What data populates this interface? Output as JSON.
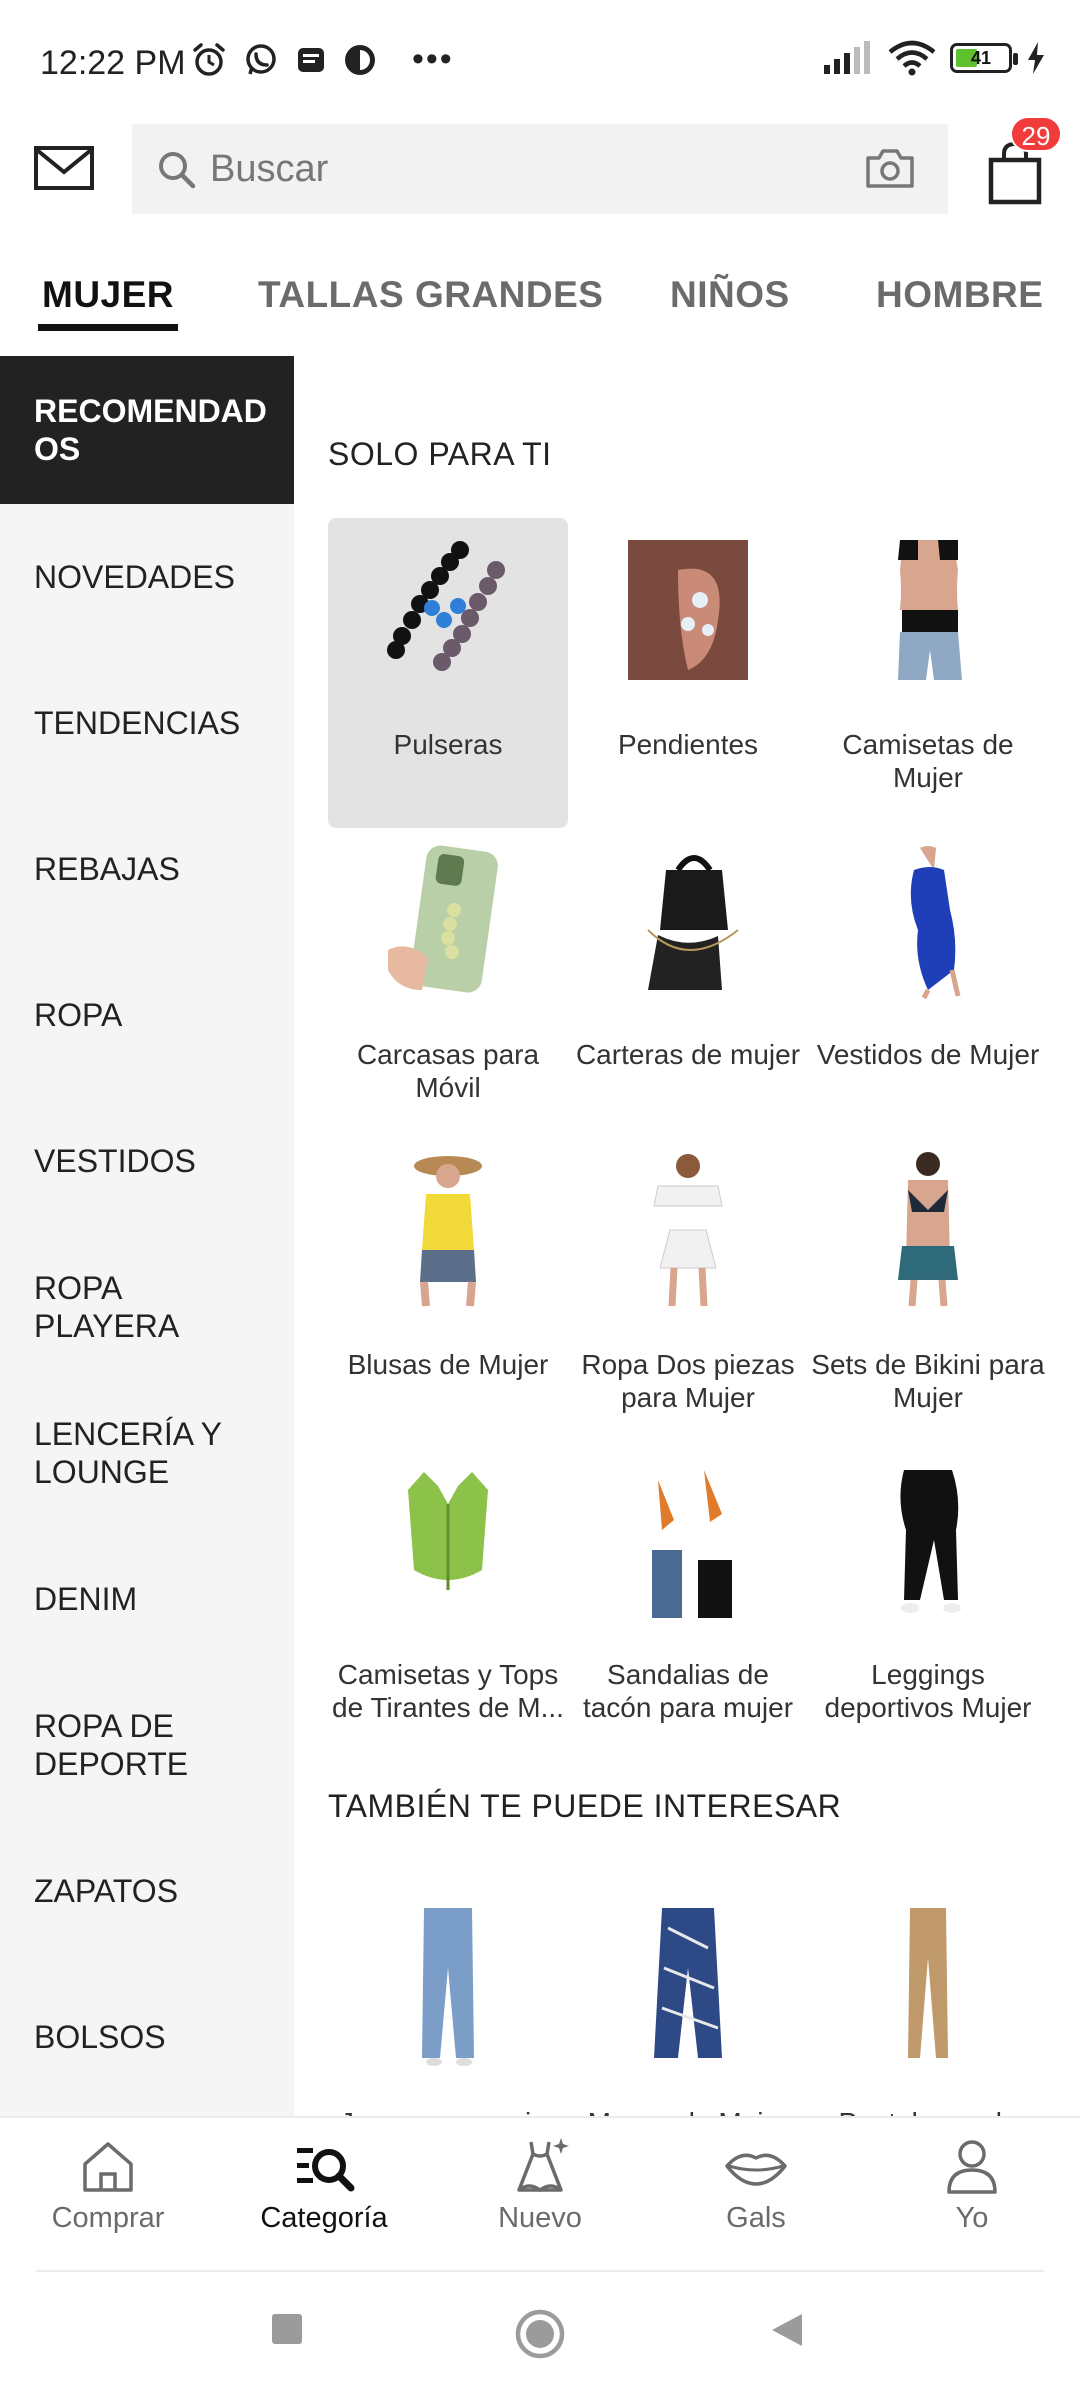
{
  "status_bar": {
    "time": "12:22 PM",
    "battery": "41",
    "battery_level": 0.41
  },
  "header": {
    "search_placeholder": "Buscar",
    "cart_count": "29"
  },
  "tabs": [
    {
      "label": "MUJER",
      "active": true
    },
    {
      "label": "TALLAS GRANDES",
      "active": false
    },
    {
      "label": "NIÑOS",
      "active": false
    },
    {
      "label": "HOMBRE",
      "active": false
    }
  ],
  "sidebar": {
    "items": [
      {
        "label": "RECOMENDADOS",
        "active": true
      },
      {
        "label": "NOVEDADES"
      },
      {
        "label": "TENDENCIAS"
      },
      {
        "label": "REBAJAS"
      },
      {
        "label": "ROPA"
      },
      {
        "label": "VESTIDOS"
      },
      {
        "label": "ROPA PLAYERA"
      },
      {
        "label": "LENCERÍA Y LOUNGE"
      },
      {
        "label": "DENIM"
      },
      {
        "label": "ROPA DE DEPORTE"
      },
      {
        "label": "ZAPATOS"
      },
      {
        "label": "BOLSOS"
      }
    ]
  },
  "sections": {
    "for_you_title": "SOLO PARA TI",
    "for_you": [
      {
        "label": "Pulseras",
        "icon": "bracelets-thumbnail"
      },
      {
        "label": "Pendientes",
        "icon": "earrings-thumbnail"
      },
      {
        "label": "Camisetas de Mujer",
        "icon": "tshirts-thumbnail"
      },
      {
        "label": "Carcasas para Móvil",
        "icon": "phone-case-thumbnail"
      },
      {
        "label": "Carteras de mujer",
        "icon": "handbag-thumbnail"
      },
      {
        "label": "Vestidos de Mujer",
        "icon": "dress-thumbnail"
      },
      {
        "label": "Blusas de Mujer",
        "icon": "blouse-thumbnail"
      },
      {
        "label": "Ropa Dos piezas para Mujer",
        "icon": "two-piece-thumbnail"
      },
      {
        "label": "Sets de Bikini para Mujer",
        "icon": "bikini-thumbnail"
      },
      {
        "label": "Camisetas y Tops de Tirantes de M...",
        "icon": "tank-top-thumbnail"
      },
      {
        "label": "Sandalias de tacón para mujer",
        "icon": "sandals-thumbnail"
      },
      {
        "label": "Leggings deportivos Mujer",
        "icon": "leggings-thumbnail"
      }
    ],
    "also_title": "TAMBIÉN TE PUEDE INTERESAR",
    "also": [
      {
        "label": "Jeans para mujer",
        "icon": "jeans-thumbnail"
      },
      {
        "label": "Monos de Mujer",
        "icon": "jumpsuit-thumbnail"
      },
      {
        "label": "Pantalones de Mujer",
        "icon": "pants-thumbnail"
      }
    ]
  },
  "bottom_nav": [
    {
      "label": "Comprar",
      "icon": "home-icon"
    },
    {
      "label": "Categoría",
      "icon": "category-search-icon",
      "active": true
    },
    {
      "label": "Nuevo",
      "icon": "new-dress-icon"
    },
    {
      "label": "Gals",
      "icon": "lips-icon"
    },
    {
      "label": "Yo",
      "icon": "profile-icon"
    }
  ],
  "colors": {
    "accent": "#222222",
    "badge": "#f23b3b",
    "battery": "#5fc02f",
    "sidebar_bg": "#f5f5f5"
  }
}
